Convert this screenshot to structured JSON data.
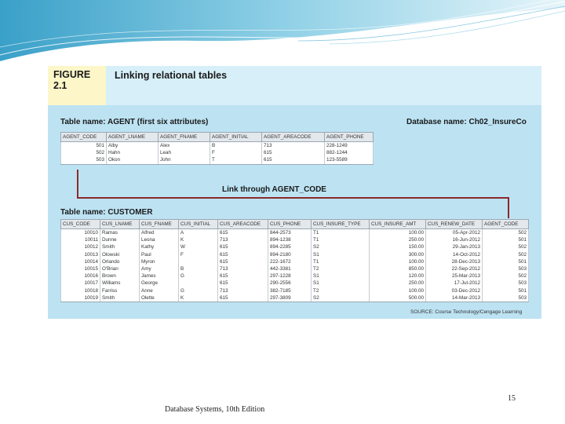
{
  "figure": {
    "label_line1": "FIGURE",
    "label_line2": "2.1",
    "title": "Linking relational tables",
    "agent_caption": "Table name: AGENT (first six attributes)",
    "database_caption": "Database name: Ch02_InsureCo",
    "link_caption": "Link through AGENT_CODE",
    "customer_caption": "Table name: CUSTOMER",
    "source": "SOURCE: Course Technology/Cengage Learning"
  },
  "agent_table": {
    "columns": [
      "AGENT_CODE",
      "AGENT_LNAME",
      "AGENT_FNAME",
      "AGENT_INITIAL",
      "AGENT_AREACODE",
      "AGENT_PHONE"
    ],
    "rows": [
      [
        "501",
        "Alby",
        "Alex",
        "B",
        "713",
        "228-1249"
      ],
      [
        "502",
        "Hahn",
        "Leah",
        "F",
        "615",
        "882-1244"
      ],
      [
        "503",
        "Okon",
        "John",
        "T",
        "615",
        "123-5589"
      ]
    ]
  },
  "customer_table": {
    "columns": [
      "CUS_CODE",
      "CUS_LNAME",
      "CUS_FNAME",
      "CUS_INITIAL",
      "CUS_AREACODE",
      "CUS_PHONE",
      "CUS_INSURE_TYPE",
      "CUS_INSURE_AMT",
      "CUS_RENEW_DATE",
      "AGENT_CODE"
    ],
    "rows": [
      [
        "10010",
        "Ramas",
        "Alfred",
        "A",
        "615",
        "844-2573",
        "T1",
        "100.00",
        "05-Apr-2012",
        "502"
      ],
      [
        "10011",
        "Dunne",
        "Leona",
        "K",
        "713",
        "894-1238",
        "T1",
        "250.00",
        "16-Jun-2012",
        "501"
      ],
      [
        "10012",
        "Smith",
        "Kathy",
        "W",
        "615",
        "894-2285",
        "S2",
        "150.00",
        "29-Jan-2013",
        "502"
      ],
      [
        "10013",
        "Olowski",
        "Paul",
        "F",
        "615",
        "894-2180",
        "S1",
        "300.00",
        "14-Oct-2012",
        "502"
      ],
      [
        "10014",
        "Orlando",
        "Myron",
        "",
        "615",
        "222-1672",
        "T1",
        "100.00",
        "28-Dec-2013",
        "501"
      ],
      [
        "10015",
        "O'Brian",
        "Amy",
        "B",
        "713",
        "442-3381",
        "T2",
        "850.00",
        "22-Sep-2012",
        "503"
      ],
      [
        "10016",
        "Brown",
        "James",
        "G",
        "615",
        "297-1228",
        "S1",
        "120.00",
        "25-Mar-2013",
        "502"
      ],
      [
        "10017",
        "Williams",
        "George",
        "",
        "615",
        "290-2556",
        "S1",
        "250.00",
        "17-Jul-2012",
        "503"
      ],
      [
        "10018",
        "Farriss",
        "Anne",
        "G",
        "713",
        "382-7185",
        "T2",
        "100.00",
        "03-Dec-2012",
        "501"
      ],
      [
        "10019",
        "Smith",
        "Olette",
        "K",
        "615",
        "297-3809",
        "S2",
        "500.00",
        "14-Mar-2013",
        "503"
      ]
    ]
  },
  "footer": {
    "book": "Database Systems, 10th Edition",
    "page": "15"
  },
  "colors": {
    "figure_bg": "#bde3f3",
    "header_bg": "#d7eff9",
    "tab_bg": "#fdf6c9",
    "link_line": "#8b2a2a"
  }
}
